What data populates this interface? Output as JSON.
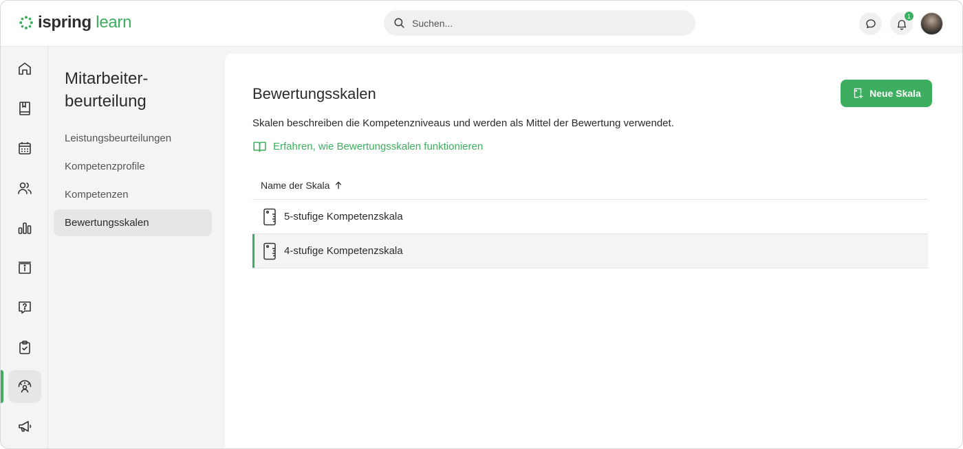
{
  "brand": {
    "word1": "ispring",
    "word2": "learn",
    "accent": "#3dae5f"
  },
  "search": {
    "placeholder": "Suchen..."
  },
  "header": {
    "notifications_count": "1"
  },
  "rail": {
    "items": [
      {
        "icon": "home-icon"
      },
      {
        "icon": "book-icon"
      },
      {
        "icon": "calendar-icon"
      },
      {
        "icon": "users-icon"
      },
      {
        "icon": "bar-chart-icon"
      },
      {
        "icon": "info-box-icon"
      },
      {
        "icon": "question-bubble-icon"
      },
      {
        "icon": "clipboard-check-icon"
      },
      {
        "icon": "performance-review-icon",
        "active": true
      },
      {
        "icon": "megaphone-icon"
      }
    ]
  },
  "sidebar": {
    "title": "Mitarbeiter-beurteilung",
    "items": [
      {
        "label": "Leistungsbeurteilungen"
      },
      {
        "label": "Kompetenzprofile"
      },
      {
        "label": "Kompetenzen"
      },
      {
        "label": "Bewertungsskalen",
        "active": true
      }
    ]
  },
  "main": {
    "title": "Bewertungsskalen",
    "new_button": "Neue Skala",
    "description": "Skalen beschreiben die Kompetenzniveaus und werden als Mittel der Bewertung verwendet.",
    "help_link": "Erfahren, wie Bewertungsskalen funktionieren",
    "table": {
      "column": "Name der Skala",
      "sort": "ascending",
      "rows": [
        {
          "name": "5-stufige Kompetenzskala",
          "icon": "ruler-icon"
        },
        {
          "name": "4-stufige Kompetenzskala",
          "icon": "ruler-icon",
          "selected": true
        }
      ]
    }
  }
}
